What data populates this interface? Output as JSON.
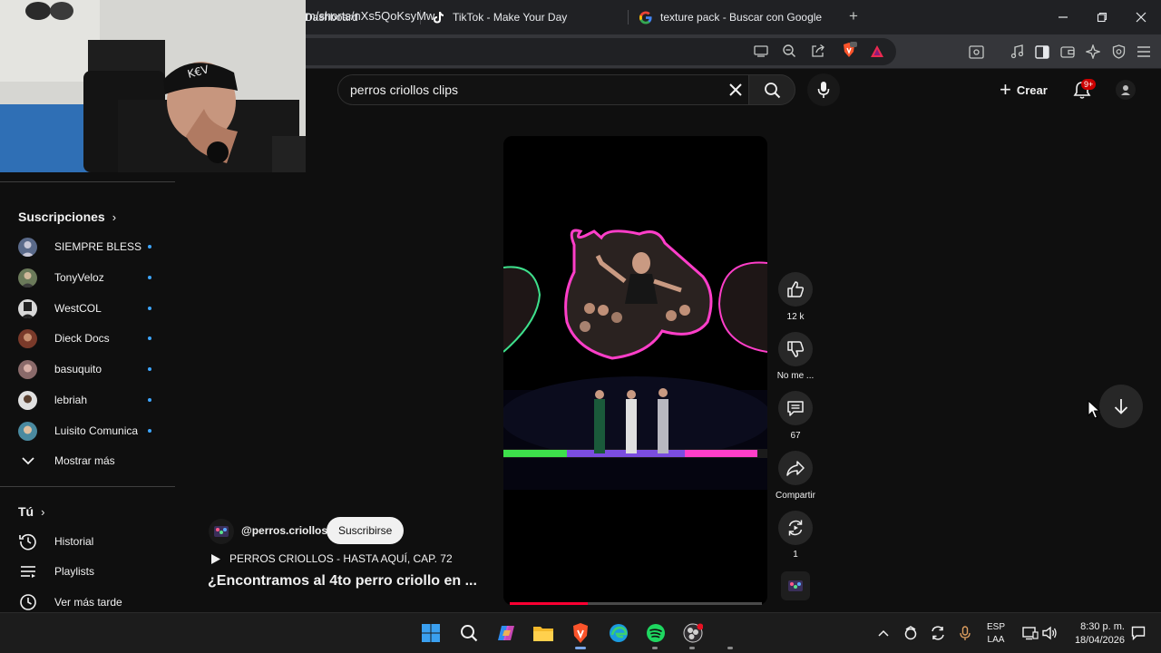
{
  "browser": {
    "tabs": [
      {
        "title": "Dashboard"
      },
      {
        "title": "TikTok - Make Your Day"
      },
      {
        "title": "texture pack - Buscar con Google"
      }
    ],
    "url": "m/shorts/nXs5QoKsyMw"
  },
  "masthead": {
    "search_value": "perros criollos clips",
    "create_label": "Crear",
    "notifications_badge": "9+"
  },
  "sidebar": {
    "subscriptions_header": "Suscripciones",
    "subscriptions": [
      {
        "name": "SIEMPRE BLESS...",
        "color": "#5a6a8a"
      },
      {
        "name": "TonyVeloz",
        "color": "#6b7a5a"
      },
      {
        "name": "WestCOL",
        "color": "#d8d8d8"
      },
      {
        "name": "Dieck Docs",
        "color": "#7a3a2a"
      },
      {
        "name": "basuquito",
        "color": "#8a6a6a"
      },
      {
        "name": "lebriah",
        "color": "#e0e0e0"
      },
      {
        "name": "Luisito Comunica",
        "color": "#4a8aa0"
      }
    ],
    "show_more_label": "Mostrar más",
    "you_header": "Tú",
    "you_items": [
      {
        "label": "Historial",
        "icon": "history-icon"
      },
      {
        "label": "Playlists",
        "icon": "playlists-icon"
      },
      {
        "label": "Ver más tarde",
        "icon": "watch-later-icon"
      }
    ]
  },
  "short": {
    "channel_handle": "@perros.criollos",
    "subscribe_label": "Suscribirse",
    "playlist_label": "PERROS CRIOLLOS - HASTA AQUÍ, CAP. 72",
    "title": "¿Encontramos al 4to perro criollo en ...",
    "progress": 0.31
  },
  "actions": {
    "like_count": "12 k",
    "dislike_label": "No me ...",
    "comment_count": "67",
    "share_label": "Compartir",
    "remix_count": "1"
  },
  "taskbar": {
    "lang_line1": "ESP",
    "lang_line2": "LAA",
    "time": "8:30 p. m.",
    "date": "18/04/2026"
  },
  "colors": {
    "accent_red": "#ff0033",
    "background": "#0f0f0f",
    "subscription_dot": "#3ea6ff"
  }
}
